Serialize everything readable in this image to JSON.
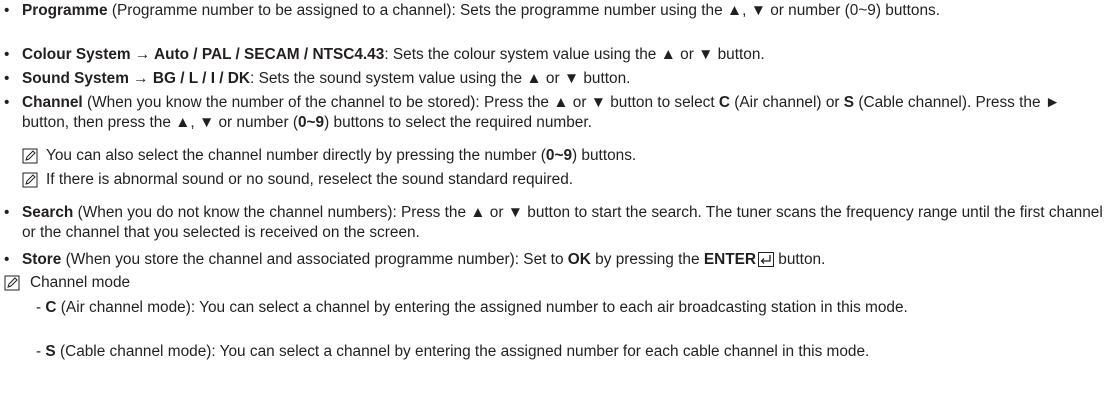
{
  "bullet_glyph": "•",
  "items": {
    "programme": {
      "term": "Programme",
      "text": " (Programme number to be assigned to a channel): Sets the programme number using the ▲, ▼ or number (0~9) buttons."
    },
    "colour": {
      "term": "Colour System → Auto / PAL / SECAM / NTSC4.43",
      "text": ": Sets the colour system value using the ▲ or ▼ button."
    },
    "sound": {
      "term": "Sound System → BG / L / I / DK",
      "text": ": Sets the sound system value using the ▲ or ▼ button."
    },
    "channel": {
      "term": "Channel",
      "t1": " (When you know the number of the channel to be stored): Press the ▲ or ▼ button to select ",
      "c": "C",
      "t2": " (Air channel) or ",
      "s": "S",
      "t3": " (Cable channel). Press the ► button, then press the ▲, ▼ or number (",
      "num": "0~9",
      "t4": ") buttons to select the required number."
    },
    "note1": {
      "t1": "You can also select the channel number directly by pressing the number (",
      "num": "0~9",
      "t2": ") buttons."
    },
    "note2": {
      "text": "If there is abnormal sound or no sound, reselect the sound standard required."
    },
    "search": {
      "term": "Search",
      "text": " (When you do not know the channel numbers): Press the ▲ or ▼ button to start the search. The tuner scans the frequency range until the first channel or the channel that you selected is received on the screen."
    },
    "store": {
      "term": "Store",
      "t1": " (When you store the channel and associated programme number): Set to ",
      "ok": "OK",
      "t2": " by pressing the ",
      "enter": "ENTER",
      "t3": " button."
    },
    "mode_note": {
      "label": "Channel mode"
    },
    "mode_c": {
      "dash": "- ",
      "letter": "C",
      "text": " (Air channel mode): You can select a channel by entering the assigned number to each air broadcasting station in this mode."
    },
    "mode_s": {
      "dash": "- ",
      "letter": "S",
      "text": " (Cable channel mode): You can select a channel by entering the assigned number for each cable channel in this mode."
    }
  },
  "icons": {
    "note": "note-pencil-icon",
    "enter": "enter-return-icon"
  }
}
